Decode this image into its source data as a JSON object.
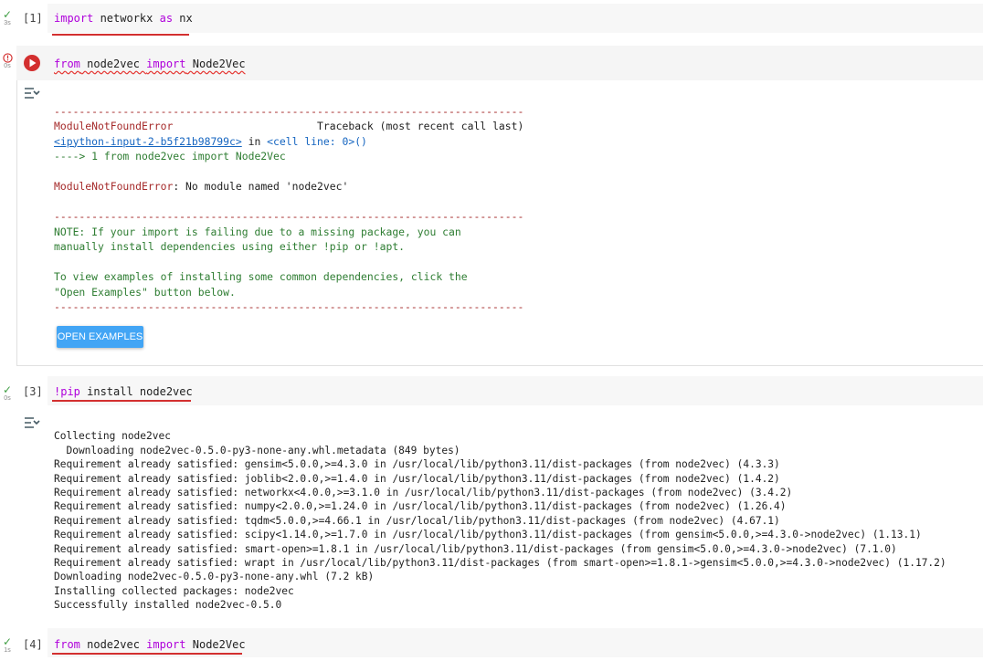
{
  "cells": [
    {
      "prompt": "[1]",
      "status_mark": "✓",
      "time": "3s",
      "code": {
        "kw1": "import",
        "plain1": " networkx ",
        "kw2": "as",
        "plain2": " nx"
      }
    },
    {
      "prompt": "",
      "status_mark": "!",
      "time": "0s",
      "code": {
        "kw1": "from",
        "plain1": " node2vec ",
        "kw2": "import",
        "plain2": " Node2Vec"
      },
      "output": {
        "dashes": "---------------------------------------------------------------------------",
        "error_name": "ModuleNotFoundError",
        "traceback_label": "Traceback (most recent call last)",
        "input_link": "<ipython-input-2-b5f21b98799c>",
        "in_word": " in ",
        "cell_line": "<cell line: 0>",
        "call_parens": "()",
        "arrow_line": "----> 1 from node2vec import Node2Vec",
        "error_msg_name": "ModuleNotFoundError",
        "error_msg": ": No module named 'node2vec'",
        "note_lines": [
          "NOTE: If your import is failing due to a missing package, you can",
          "manually install dependencies using either !pip or !apt.",
          "",
          "To view examples of installing some common dependencies, click the",
          "\"Open Examples\" button below."
        ],
        "button_label": "OPEN EXAMPLES"
      }
    },
    {
      "prompt": "[3]",
      "status_mark": "✓",
      "time": "0s",
      "code": {
        "kw1": "!pip",
        "plain1": " install node2vec"
      },
      "output_lines": [
        "Collecting node2vec",
        "  Downloading node2vec-0.5.0-py3-none-any.whl.metadata (849 bytes)",
        "Requirement already satisfied: gensim<5.0.0,>=4.3.0 in /usr/local/lib/python3.11/dist-packages (from node2vec) (4.3.3)",
        "Requirement already satisfied: joblib<2.0.0,>=1.4.0 in /usr/local/lib/python3.11/dist-packages (from node2vec) (1.4.2)",
        "Requirement already satisfied: networkx<4.0.0,>=3.1.0 in /usr/local/lib/python3.11/dist-packages (from node2vec) (3.4.2)",
        "Requirement already satisfied: numpy<2.0.0,>=1.24.0 in /usr/local/lib/python3.11/dist-packages (from node2vec) (1.26.4)",
        "Requirement already satisfied: tqdm<5.0.0,>=4.66.1 in /usr/local/lib/python3.11/dist-packages (from node2vec) (4.67.1)",
        "Requirement already satisfied: scipy<1.14.0,>=1.7.0 in /usr/local/lib/python3.11/dist-packages (from gensim<5.0.0,>=4.3.0->node2vec) (1.13.1)",
        "Requirement already satisfied: smart-open>=1.8.1 in /usr/local/lib/python3.11/dist-packages (from gensim<5.0.0,>=4.3.0->node2vec) (7.1.0)",
        "Requirement already satisfied: wrapt in /usr/local/lib/python3.11/dist-packages (from smart-open>=1.8.1->gensim<5.0.0,>=4.3.0->node2vec) (1.17.2)",
        "Downloading node2vec-0.5.0-py3-none-any.whl (7.2 kB)",
        "Installing collected packages: node2vec",
        "Successfully installed node2vec-0.5.0"
      ]
    },
    {
      "prompt": "[4]",
      "status_mark": "✓",
      "time": "1s",
      "code": {
        "kw1": "from",
        "plain1": " node2vec ",
        "kw2": "import",
        "plain2": " Node2Vec"
      }
    }
  ],
  "icons": {
    "run_button": "play-circle-icon",
    "output_toggle": "output-expand-icon",
    "success": "check-icon",
    "error": "error-circle-icon"
  },
  "colors": {
    "keyword": "#af00db",
    "error_red": "#a52a2a",
    "note_green": "#2e7d32",
    "link_blue": "#1565c0",
    "button_blue": "#42a5f5",
    "underline_red": "#d32f2f",
    "error_status": "#d32f2f",
    "success_status": "#43a047"
  }
}
